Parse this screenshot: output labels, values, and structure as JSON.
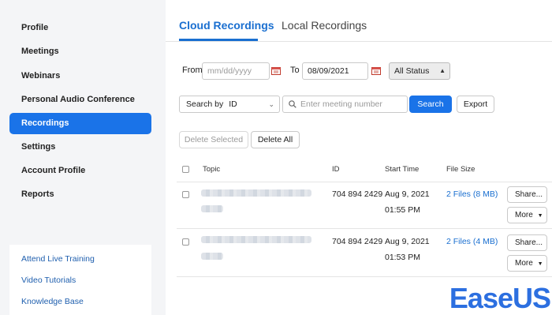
{
  "sidebar": {
    "items": [
      {
        "label": "Profile",
        "active": false
      },
      {
        "label": "Meetings",
        "active": false
      },
      {
        "label": "Webinars",
        "active": false
      },
      {
        "label": "Personal Audio Conference",
        "active": false
      },
      {
        "label": "Recordings",
        "active": true
      },
      {
        "label": "Settings",
        "active": false
      },
      {
        "label": "Account Profile",
        "active": false
      },
      {
        "label": "Reports",
        "active": false
      }
    ],
    "links": [
      "Attend Live Training",
      "Video Tutorials",
      "Knowledge Base"
    ]
  },
  "tabs": [
    {
      "label": "Cloud Recordings",
      "active": true
    },
    {
      "label": "Local Recordings",
      "active": false
    }
  ],
  "filters": {
    "from_label": "From",
    "from_placeholder": "mm/dd/yyyy",
    "to_label": "To",
    "to_value": "08/09/2021",
    "status_value": "All Status",
    "search_by_label": "Search by",
    "search_by_value": "ID",
    "search_placeholder": "Enter meeting number",
    "search_button": "Search",
    "export_button": "Export"
  },
  "actions": {
    "delete_selected": "Delete Selected",
    "delete_all": "Delete All"
  },
  "table": {
    "headers": [
      "Topic",
      "ID",
      "Start Time",
      "File Size"
    ],
    "rows": [
      {
        "id": "704 894 2429",
        "date": "Aug 9, 2021",
        "time": "01:55 PM",
        "files": "2 Files (8 MB)",
        "share": "Share...",
        "more": "More"
      },
      {
        "id": "704 894 2429",
        "date": "Aug 9, 2021",
        "time": "01:53 PM",
        "files": "2 Files (4 MB)",
        "share": "Share...",
        "more": "More"
      }
    ]
  },
  "watermark": "EaseUS",
  "colors": {
    "accent": "#1a73e8",
    "link": "#1a6fd0",
    "sidebar_bg": "#f4f5f7"
  }
}
